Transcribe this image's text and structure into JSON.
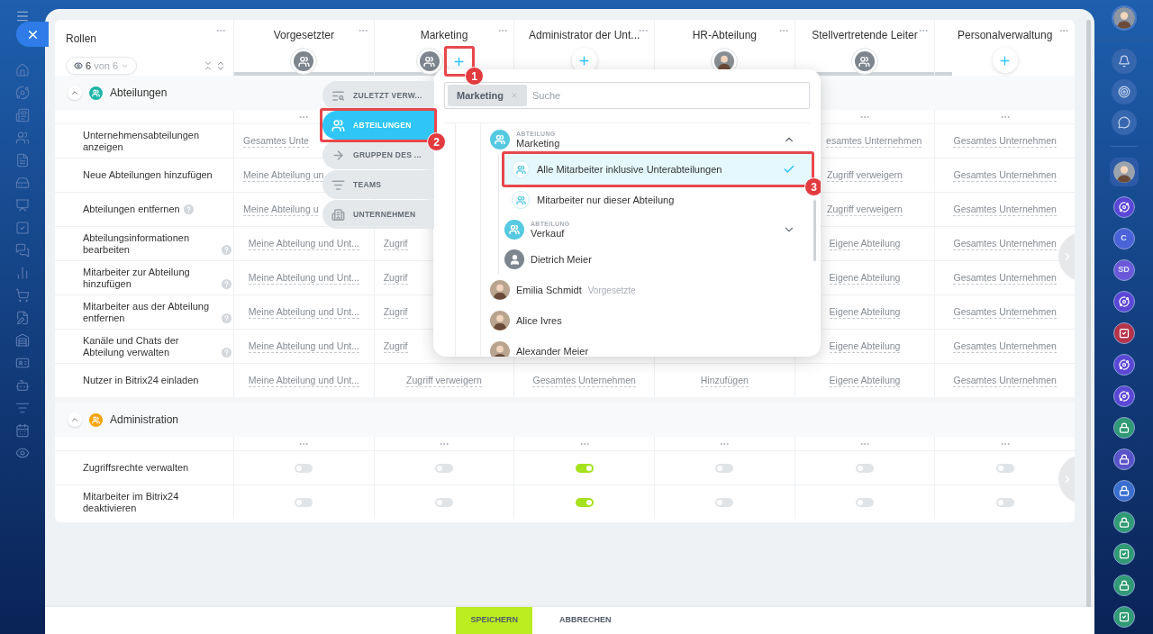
{
  "table": {
    "roles_header": {
      "title": "Rollen",
      "count": "6",
      "total": "von 6"
    },
    "columns": [
      {
        "title": "Vorgesetzter",
        "members": [
          {
            "kind": "group"
          }
        ]
      },
      {
        "title": "Marketing",
        "members": [
          {
            "kind": "group"
          },
          {
            "kind": "add",
            "callout": "1"
          }
        ]
      },
      {
        "title": "Administrator der Unt...",
        "members": [
          {
            "kind": "add"
          }
        ]
      },
      {
        "title": "HR-Abteilung",
        "members": [
          {
            "kind": "person"
          }
        ]
      },
      {
        "title": "Stellvertretende Leiter",
        "members": [
          {
            "kind": "group"
          }
        ]
      },
      {
        "title": "Personalverwaltung",
        "members": [
          {
            "kind": "add"
          }
        ]
      }
    ],
    "sections": [
      {
        "title": "Abteilungen",
        "color": "#1fb5a9",
        "expanded": true,
        "column_menus": [
          true,
          false,
          false,
          false,
          true,
          true
        ],
        "rows": [
          {
            "label": "Unternehmensabteilungen anzeigen",
            "help": false,
            "kind": "select",
            "cells": [
              {
                "text": "Gesamtes Unte",
                "covered_right": true
              },
              null,
              null,
              null,
              {
                "text": "esamtes Unternehmen",
                "covered_left": true
              },
              {
                "text": "Gesamtes Unternehmen"
              }
            ]
          },
          {
            "label": "Neue Abteilungen hinzufügen",
            "help": false,
            "kind": "select",
            "cells": [
              {
                "text": "Meine Abteilung un",
                "covered_right": true
              },
              null,
              null,
              null,
              {
                "text": "Zugriff verweigern"
              },
              {
                "text": "Gesamtes Unternehmen"
              }
            ]
          },
          {
            "label": "Abteilungen entfernen",
            "help": true,
            "kind": "select",
            "cells": [
              {
                "text": "Meine Abteilung u",
                "covered_right": true
              },
              null,
              null,
              null,
              {
                "text": "Zugriff verweigern"
              },
              {
                "text": "Gesamtes Unternehmen"
              }
            ]
          },
          {
            "label": "Abteilungsinformationen bearbeiten",
            "help": true,
            "kind": "select",
            "cells": [
              {
                "text": "Meine Abteilung und Unt..."
              },
              {
                "text": "Zugrif",
                "covered_right": true
              },
              null,
              null,
              {
                "text": "Eigene Abteilung"
              },
              {
                "text": "Gesamtes Unternehmen"
              }
            ]
          },
          {
            "label": "Mitarbeiter zur Abteilung hinzufügen",
            "help": true,
            "kind": "select",
            "cells": [
              {
                "text": "Meine Abteilung und Unt..."
              },
              {
                "text": "Zugrif",
                "covered_right": true
              },
              null,
              null,
              {
                "text": "Eigene Abteilung"
              },
              {
                "text": "Gesamtes Unternehmen"
              }
            ]
          },
          {
            "label": "Mitarbeiter aus der Abteilung entfernen",
            "help": true,
            "kind": "select",
            "cells": [
              {
                "text": "Meine Abteilung und Unt..."
              },
              {
                "text": "Zugrif",
                "covered_right": true
              },
              null,
              null,
              {
                "text": "Eigene Abteilung"
              },
              {
                "text": "Gesamtes Unternehmen"
              }
            ]
          },
          {
            "label": "Kanäle und Chats der Abteilung verwalten",
            "help": true,
            "kind": "select",
            "cells": [
              {
                "text": "Meine Abteilung und Unt..."
              },
              {
                "text": "Zugrif",
                "covered_right": true
              },
              null,
              null,
              {
                "text": "Eigene Abteilung"
              },
              {
                "text": "Gesamtes Unternehmen"
              }
            ]
          },
          {
            "label": "Nutzer in Bitrix24 einladen",
            "help": false,
            "kind": "select",
            "cells": [
              {
                "text": "Meine Abteilung und Unt..."
              },
              {
                "text": "Zugriff verweigern"
              },
              {
                "text": "Gesamtes Unternehmen"
              },
              {
                "text": "Hinzufügen"
              },
              {
                "text": "Eigene Abteilung"
              },
              {
                "text": "Gesamtes Unternehmen"
              }
            ]
          }
        ]
      },
      {
        "title": "Administration",
        "color": "#f5a300",
        "expanded": true,
        "column_menus": [
          true,
          true,
          true,
          true,
          true,
          true
        ],
        "rows": [
          {
            "label": "Zugriffsrechte verwalten",
            "help": false,
            "kind": "toggle",
            "cells": [
              {
                "on": false
              },
              {
                "on": false
              },
              {
                "on": true
              },
              {
                "on": false
              },
              {
                "on": false
              },
              {
                "on": false
              }
            ]
          },
          {
            "label": "Mitarbeiter im Bitrix24 deaktivieren",
            "help": false,
            "kind": "toggle",
            "cells": [
              {
                "on": false
              },
              {
                "on": false
              },
              {
                "on": true
              },
              {
                "on": false
              },
              {
                "on": false
              },
              {
                "on": false
              }
            ]
          }
        ]
      }
    ]
  },
  "selector_tabs": [
    {
      "label": "ZULETZT VERW...",
      "kind": "recent",
      "selected": false
    },
    {
      "label": "ABTEILUNGEN",
      "kind": "departments",
      "selected": true,
      "callout": "2"
    },
    {
      "label": "GRUPPEN DES ...",
      "kind": "groups",
      "selected": false
    },
    {
      "label": "TEAMS",
      "kind": "teams",
      "selected": false
    },
    {
      "label": "UNTERNEHMEN",
      "kind": "company",
      "selected": false
    }
  ],
  "selector": {
    "chips": [
      "Marketing"
    ],
    "placeholder": "Suche",
    "items": [
      {
        "kind": "department",
        "caption": "ABTEILUNG",
        "name": "Marketing",
        "expanded": true,
        "children": [
          {
            "kind": "option",
            "label": "Alle Mitarbeiter inklusive Unterabteilungen",
            "selected": true,
            "callout": "3"
          },
          {
            "kind": "option",
            "label": "Mitarbeiter nur dieser Abteilung",
            "selected": false
          },
          {
            "kind": "department",
            "caption": "ABTEILUNG",
            "name": "Verkauf",
            "expanded": false
          },
          {
            "kind": "user",
            "name": "Dietrich Meier"
          }
        ]
      },
      {
        "kind": "person",
        "name": "Emilia Schmidt",
        "role": "Vorgesetzte"
      },
      {
        "kind": "person",
        "name": "Alice Ivres"
      },
      {
        "kind": "person",
        "name": "Alexander Meier"
      }
    ]
  },
  "footer": {
    "buttons": [
      {
        "label": "SPEICHERN",
        "kind": "primary"
      },
      {
        "label": "ABBRECHEN",
        "kind": "link"
      }
    ]
  },
  "rail": [
    {
      "kind": "avatar"
    },
    {
      "kind": "orbit",
      "color": "#5b47d6"
    },
    {
      "kind": "initials",
      "text": "C",
      "color": "#4a63d8"
    },
    {
      "kind": "initials",
      "text": "SD",
      "color": "#6b58d9"
    },
    {
      "kind": "orbit",
      "color": "#5b47d6"
    },
    {
      "kind": "task",
      "color": "#b5344a"
    },
    {
      "kind": "orbit",
      "color": "#5b47d6"
    },
    {
      "kind": "orbit",
      "color": "#5b47d6"
    },
    {
      "kind": "lock",
      "color": "#2f9a73"
    },
    {
      "kind": "lock",
      "color": "#5a52c9"
    },
    {
      "kind": "lock",
      "color": "#3a6fd0"
    },
    {
      "kind": "lock",
      "color": "#2f9a73"
    },
    {
      "kind": "task",
      "color": "#2f9a73"
    },
    {
      "kind": "lock",
      "color": "#2f9a73"
    },
    {
      "kind": "task",
      "color": "#2f9a73"
    }
  ]
}
